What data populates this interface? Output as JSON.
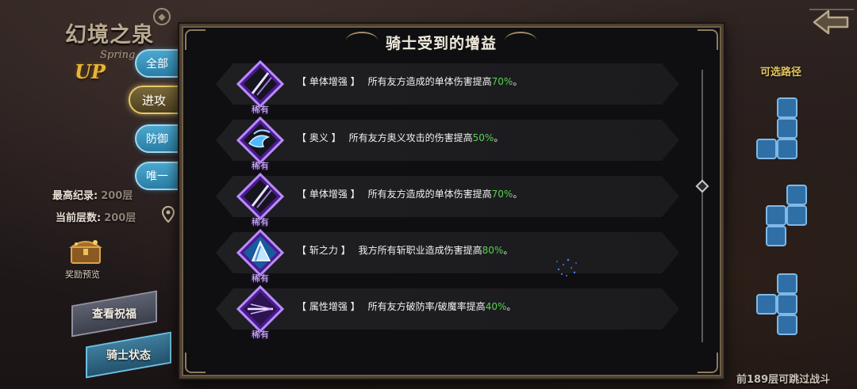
{
  "logo": {
    "title": "幻境之泉",
    "subtitle": "Spring",
    "badge": "UP"
  },
  "filter_tabs": [
    {
      "label": "全部",
      "active": false
    },
    {
      "label": "进攻",
      "active": true
    },
    {
      "label": "防御",
      "active": false
    },
    {
      "label": "唯一",
      "active": false
    }
  ],
  "stats": {
    "best_label": "最高纪录:",
    "best_value": "200层",
    "current_label": "当前层数:",
    "current_value": "200层"
  },
  "reward_preview_label": "奖励预览",
  "buttons": {
    "view_blessing": "查看祝福",
    "knight_status": "骑士状态"
  },
  "panel": {
    "title": "骑士受到的增益"
  },
  "buffs": [
    {
      "rarity": "稀有",
      "tag": "【 单体增强 】",
      "desc": "所有友方造成的单体伤害提高",
      "pct": "70%",
      "tail": "。",
      "icon": "sword-slash-icon",
      "color": "#7b2fe0"
    },
    {
      "rarity": "稀有",
      "tag": "【 奥义 】",
      "desc": "所有友方奥义攻击的伤害提高",
      "pct": "50%",
      "tail": "。",
      "icon": "swirl-wave-icon",
      "color": "#7b2fe0"
    },
    {
      "rarity": "稀有",
      "tag": "【 单体增强 】",
      "desc": "所有友方造成的单体伤害提高",
      "pct": "70%",
      "tail": "。",
      "icon": "sword-slash-icon",
      "color": "#7b2fe0"
    },
    {
      "rarity": "稀有",
      "tag": "【 斩之力 】",
      "desc": "我方所有斩职业造成伤害提高",
      "pct": "80%",
      "tail": "。",
      "icon": "blade-shard-icon",
      "color": "#7b2fe0"
    },
    {
      "rarity": "稀有",
      "tag": "【 属性增强 】",
      "desc": "所有友方破防率/破魔率提高",
      "pct": "40%",
      "tail": "。",
      "icon": "piercing-arrow-icon",
      "color": "#7b2fe0"
    }
  ],
  "paths": {
    "title": "可选路径",
    "skip_text": "前189层可跳过战斗"
  },
  "colors": {
    "highlight_green": "#55d34f",
    "gold": "#e4c65c",
    "tab_blue": "#2b7ea6",
    "rare_purple": "#7b2fe0"
  }
}
